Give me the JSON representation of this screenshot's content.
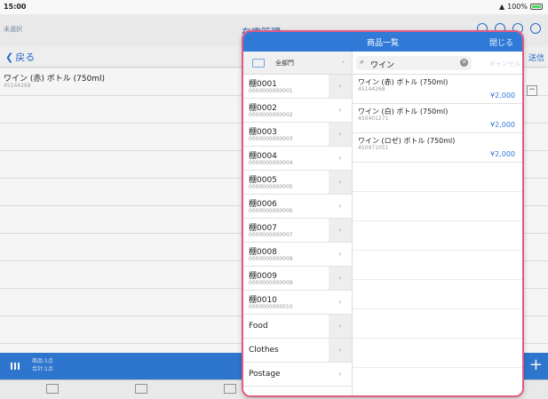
{
  "status": {
    "time": "15:00",
    "battery": "100%"
  },
  "background": {
    "subtitle": "未選択",
    "title": "在庫管理",
    "back_label": "戻る",
    "send_label": "送信",
    "row": {
      "name": "ワイン (赤) ボトル (750ml)",
      "code": "45144268"
    },
    "summary": {
      "line1": "商品:1点",
      "line2": "合計:1点"
    }
  },
  "modal": {
    "title": "商品一覧",
    "close_label": "閉じる",
    "all_categories": "全部門",
    "categories": [
      {
        "name": "棚0001",
        "code": "0000000000001"
      },
      {
        "name": "棚0002",
        "code": "0000000000002"
      },
      {
        "name": "棚0003",
        "code": "0000000000003"
      },
      {
        "name": "棚0004",
        "code": "0000000000004"
      },
      {
        "name": "棚0005",
        "code": "0000000000005"
      },
      {
        "name": "棚0006",
        "code": "0000000000006"
      },
      {
        "name": "棚0007",
        "code": "0000000000007"
      },
      {
        "name": "棚0008",
        "code": "0000000000008"
      },
      {
        "name": "棚0009",
        "code": "0000000000009"
      },
      {
        "name": "棚0010",
        "code": "0000000000010"
      },
      {
        "name": "Food",
        "code": ""
      },
      {
        "name": "Clothes",
        "code": ""
      },
      {
        "name": "Postage",
        "code": ""
      }
    ],
    "search": {
      "value": "ワイン",
      "cancel_label": "キャンセル"
    },
    "products": [
      {
        "name": "ワイン (赤) ボトル (750ml)",
        "code": "45144268",
        "price": "¥2,000"
      },
      {
        "name": "ワイン (白) ボトル (750ml)",
        "code": "450401271",
        "price": "¥2,000"
      },
      {
        "name": "ワイン (ロゼ) ボトル (750ml)",
        "code": "450971051",
        "price": "¥2,000"
      }
    ]
  },
  "colors": {
    "accent": "#2f7ad6",
    "highlight_border": "#e05a84"
  }
}
